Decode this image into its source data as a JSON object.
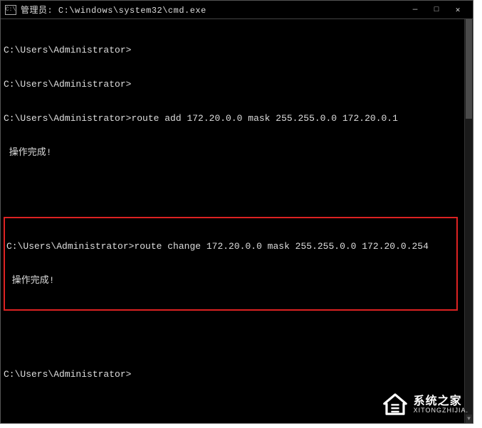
{
  "titlebar": {
    "icon_label": "C:\\",
    "title": "管理员: C:\\windows\\system32\\cmd.exe",
    "minimize": "—",
    "maximize": "□",
    "close": "✕"
  },
  "terminal": {
    "line1_prompt": "C:\\Users\\Administrator>",
    "line2_prompt": "C:\\Users\\Administrator>",
    "line3_prompt": "C:\\Users\\Administrator>",
    "line3_cmd": "route add 172.20.0.0 mask 255.255.0.0 172.20.0.1",
    "line4_result": " 操作完成!",
    "box_prompt": "C:\\Users\\Administrator>",
    "box_cmd": "route change 172.20.0.0 mask 255.255.0.0 172.20.0.254",
    "box_result": " 操作完成!",
    "last_prompt": "C:\\Users\\Administrator>"
  },
  "watermark": {
    "main": "系统之家",
    "sub": "XITONGZHIJIA."
  },
  "scroll": {
    "up_glyph": "▲",
    "down_glyph": "▼"
  }
}
